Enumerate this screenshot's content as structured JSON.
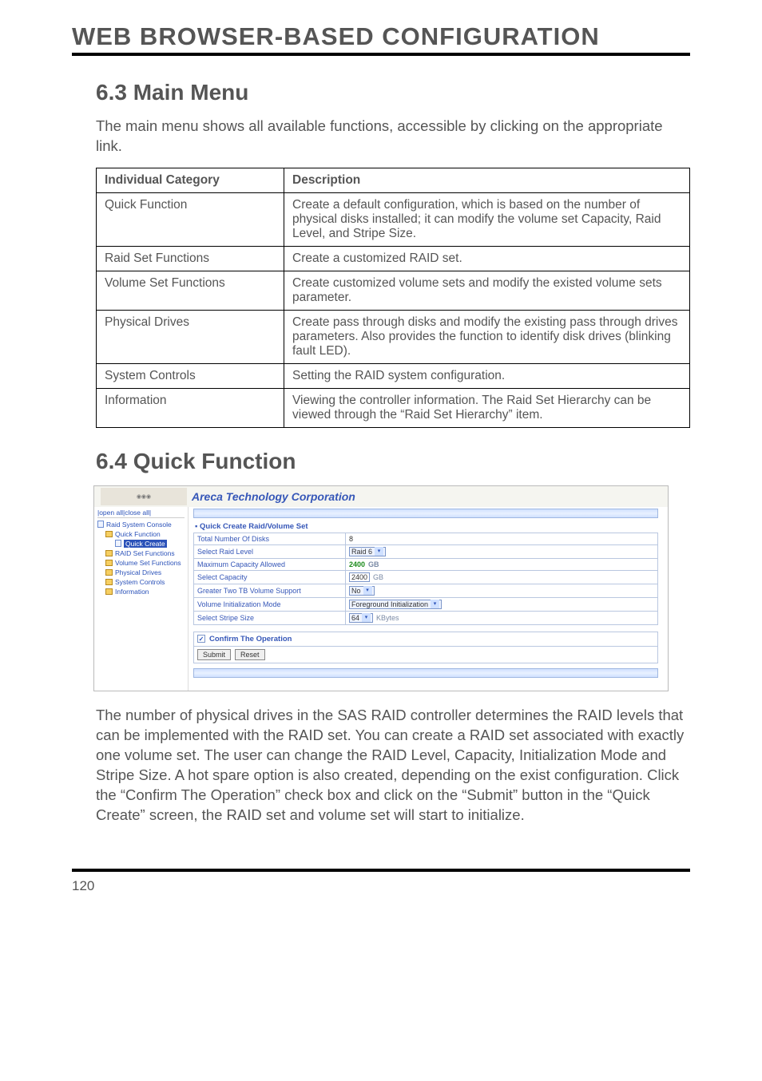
{
  "header": {
    "title": "WEB BROWSER-BASED CONFIGURATION"
  },
  "section63": {
    "title": "6.3 Main Menu",
    "intro": "The main menu shows all available functions, accessible by clicking on the appropriate link.",
    "table": {
      "headers": [
        "Individual Category",
        "Description"
      ],
      "rows": [
        {
          "cat": "Quick Function",
          "desc": "Create a default configuration, which is based on the number of physical disks installed; it can modify the volume set Capacity, Raid Level, and Stripe Size."
        },
        {
          "cat": "Raid Set Functions",
          "desc": "Create a customized RAID set."
        },
        {
          "cat": "Volume Set Functions",
          "desc": "Create customized volume sets and modify the existed volume sets parameter."
        },
        {
          "cat": "Physical Drives",
          "desc": "Create pass through disks and modify the existing pass through drives parameters. Also provides the function to identify disk drives (blinking fault LED)."
        },
        {
          "cat": "System Controls",
          "desc": "Setting the RAID system configuration."
        },
        {
          "cat": "Information",
          "desc": "Viewing the controller information. The Raid Set Hierarchy can be viewed through the “Raid Set Hierarchy” item."
        }
      ]
    }
  },
  "section64": {
    "title": "6.4 Quick Function",
    "body": "The number of physical drives in the SAS RAID controller determines the RAID levels that can be implemented with the RAID set. You can create a RAID set associated with exactly one volume set. The user can change the RAID Level, Capacity, Initialization Mode and Stripe Size. A hot spare option is also created, depending on the exist configuration. Click the “Confirm The Operation” check box and click on the “Submit” button in the “Quick Create” screen, the RAID set and volume set will start to initialize."
  },
  "screenshot": {
    "brand": "Areca Technology Corporation",
    "left": {
      "toggles": "|open all|close all|",
      "root": "Raid System Console",
      "items": [
        {
          "label": "Quick Function"
        },
        {
          "label": "Quick Create",
          "selected": true
        },
        {
          "label": "RAID Set Functions"
        },
        {
          "label": "Volume Set Functions"
        },
        {
          "label": "Physical Drives"
        },
        {
          "label": "System Controls"
        },
        {
          "label": "Information"
        }
      ]
    },
    "panel": {
      "title": "▪ Quick Create Raid/Volume Set",
      "rows": [
        {
          "label": "Total Number Of Disks",
          "value": "8",
          "kind": "text"
        },
        {
          "label": "Select Raid Level",
          "value": "Raid 6",
          "kind": "select"
        },
        {
          "label": "Maximum Capacity Allowed",
          "value": "2400",
          "unit": "GB",
          "kind": "green"
        },
        {
          "label": "Select Capacity",
          "value": "2400",
          "unit": "GB",
          "kind": "input"
        },
        {
          "label": "Greater Two TB Volume Support",
          "value": "No",
          "kind": "select"
        },
        {
          "label": "Volume Initialization Mode",
          "value": "Foreground Initialization",
          "kind": "select"
        },
        {
          "label": "Select Stripe Size",
          "value": "64",
          "unit": "KBytes",
          "kind": "select-unit"
        }
      ],
      "confirm": "Confirm The Operation",
      "buttons": [
        "Submit",
        "Reset"
      ]
    }
  },
  "page_number": "120"
}
